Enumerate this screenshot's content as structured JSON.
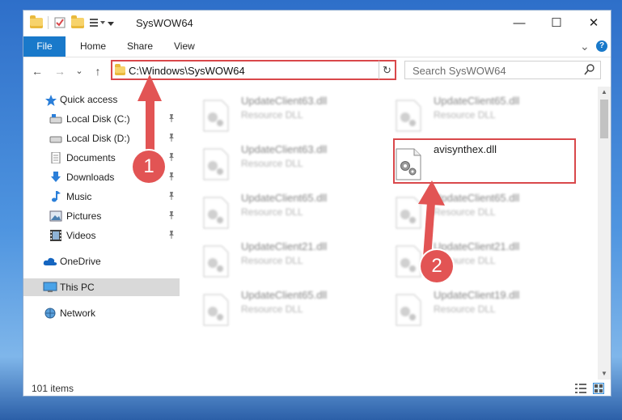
{
  "window": {
    "title": "SysWOW64",
    "minimize_glyph": "—",
    "maximize_glyph": "☐",
    "close_glyph": "✕"
  },
  "ribbon": {
    "tabs": [
      "File",
      "Home",
      "Share",
      "View"
    ],
    "expand_glyph": "⌄",
    "help_glyph": "?"
  },
  "address": {
    "path": "C:\\Windows\\SysWOW64",
    "back_glyph": "←",
    "forward_glyph": "→",
    "recent_glyph": "⌄",
    "up_glyph": "↑",
    "refresh_glyph": "↻"
  },
  "search": {
    "placeholder": "Search SysWOW64",
    "icon": "search-icon"
  },
  "nav": {
    "items": [
      {
        "label": "Quick access",
        "icon": "star-icon",
        "pinned": false
      },
      {
        "label": "Local Disk (C:)",
        "icon": "drive-icon",
        "pinned": true
      },
      {
        "label": "Local Disk (D:)",
        "icon": "drive-icon",
        "pinned": true
      },
      {
        "label": "Documents",
        "icon": "documents-icon",
        "pinned": true
      },
      {
        "label": "Downloads",
        "icon": "download-icon",
        "pinned": true
      },
      {
        "label": "Music",
        "icon": "music-icon",
        "pinned": true
      },
      {
        "label": "Pictures",
        "icon": "pictures-icon",
        "pinned": true
      },
      {
        "label": "Videos",
        "icon": "videos-icon",
        "pinned": true
      },
      {
        "label": "OneDrive",
        "icon": "cloud-icon",
        "pinned": false
      },
      {
        "label": "This PC",
        "icon": "computer-icon",
        "pinned": false,
        "selected": true
      },
      {
        "label": "Network",
        "icon": "network-icon",
        "pinned": false
      }
    ],
    "pin_glyph": "📌"
  },
  "files": [
    {
      "name": "UpdateClient63.dll",
      "type": "Resource DLL"
    },
    {
      "name": "UpdateClient65.dll",
      "type": "Resource DLL"
    },
    {
      "name": "UpdateClient63.dll",
      "type": "Resource DLL"
    },
    {
      "name": "avisynthex.dll",
      "type": ""
    },
    {
      "name": "UpdateClient65.dll",
      "type": "Resource DLL"
    },
    {
      "name": "UpdateClient65.dll",
      "type": "Resource DLL"
    },
    {
      "name": "UpdateClient21.dll",
      "type": "Resource DLL"
    },
    {
      "name": "UpdateClient21.dll",
      "type": "Resource DLL"
    },
    {
      "name": "UpdateClient65.dll",
      "type": "Resource DLL"
    },
    {
      "name": "UpdateClient19.dll",
      "type": "Resource DLL"
    }
  ],
  "status": {
    "item_count": "101 items"
  },
  "annotations": {
    "step1": "1",
    "step2": "2",
    "color": "#e25454"
  }
}
